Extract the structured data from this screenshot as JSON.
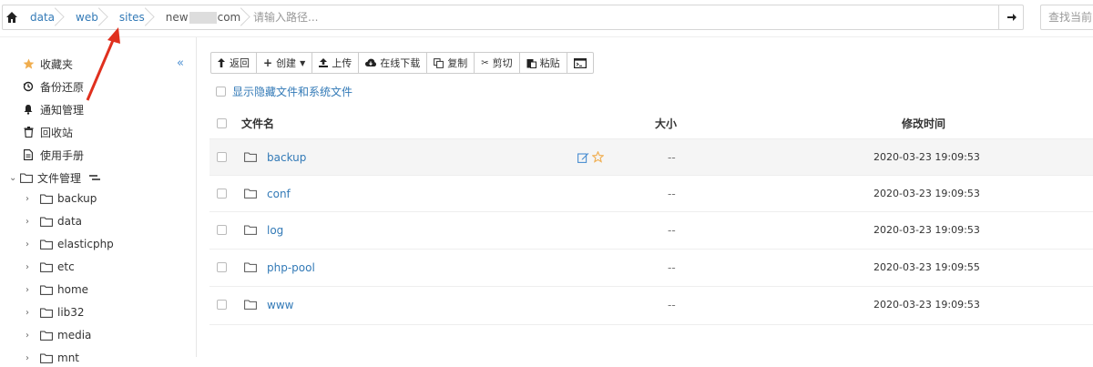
{
  "breadcrumb": {
    "items": [
      "data",
      "web",
      "sites"
    ],
    "masked_prefix": "new",
    "masked_suffix": "com"
  },
  "path_input": {
    "placeholder": "请输入路径..."
  },
  "search": {
    "placeholder": "查找当前"
  },
  "sidebar": {
    "collapse_label": "«",
    "items": [
      {
        "label": "收藏夹",
        "icon": "star-icon"
      },
      {
        "label": "备份还原",
        "icon": "history-icon"
      },
      {
        "label": "通知管理",
        "icon": "bell-icon"
      },
      {
        "label": "回收站",
        "icon": "trash-icon"
      },
      {
        "label": "使用手册",
        "icon": "file-icon"
      }
    ],
    "file_manager": {
      "label": "文件管理"
    },
    "tree": [
      "backup",
      "data",
      "elasticphp",
      "etc",
      "home",
      "lib32",
      "media",
      "mnt"
    ]
  },
  "toolbar": {
    "back": "返回",
    "create": "创建",
    "upload": "上传",
    "download": "在线下载",
    "copy": "复制",
    "cut": "剪切",
    "paste": "粘贴"
  },
  "show_hidden_label": "显示隐藏文件和系统文件",
  "table": {
    "headers": {
      "name": "文件名",
      "size": "大小",
      "time": "修改时间"
    },
    "rows": [
      {
        "name": "backup",
        "size": "--",
        "time": "2020-03-23 19:09:53"
      },
      {
        "name": "conf",
        "size": "--",
        "time": "2020-03-23 19:09:53"
      },
      {
        "name": "log",
        "size": "--",
        "time": "2020-03-23 19:09:53"
      },
      {
        "name": "php-pool",
        "size": "--",
        "time": "2020-03-23 19:09:55"
      },
      {
        "name": "www",
        "size": "--",
        "time": "2020-03-23 19:09:53"
      }
    ]
  },
  "colors": {
    "link": "#337ab7",
    "star": "#f0ad4e",
    "arrow": "#e0301e"
  }
}
